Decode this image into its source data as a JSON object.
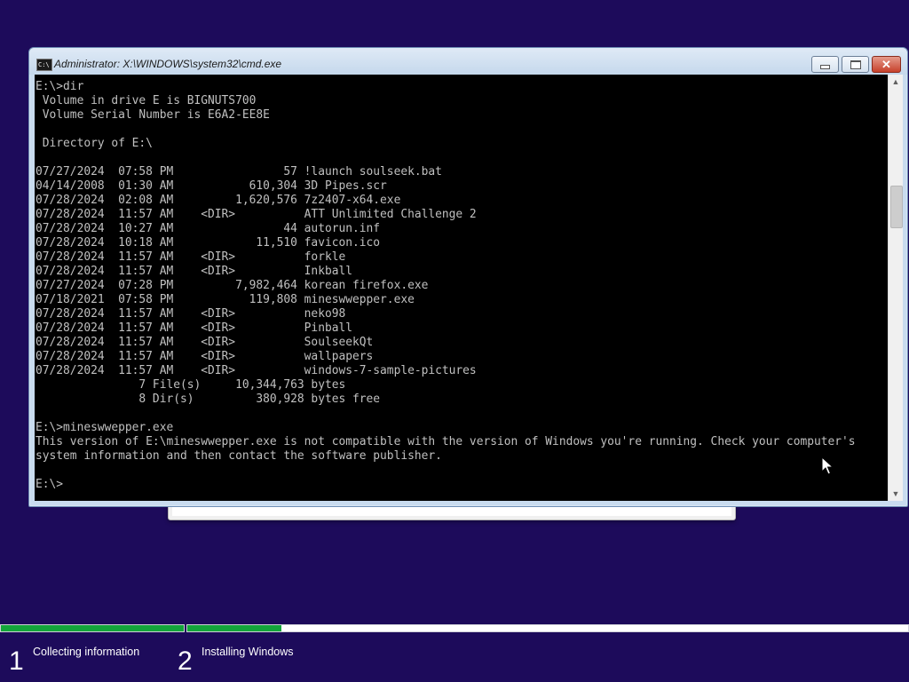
{
  "window": {
    "title": "Administrator: X:\\WINDOWS\\system32\\cmd.exe",
    "icon": "console-icon",
    "controls": {
      "minimize": "minimize-icon",
      "maximize": "maximize-icon",
      "close": "close-icon"
    }
  },
  "console": {
    "text": "E:\\>dir\n Volume in drive E is BIGNUTS700\n Volume Serial Number is E6A2-EE8E\n\n Directory of E:\\\n\n07/27/2024  07:58 PM                57 !launch soulseek.bat\n04/14/2008  01:30 AM           610,304 3D Pipes.scr\n07/28/2024  02:08 AM         1,620,576 7z2407-x64.exe\n07/28/2024  11:57 AM    <DIR>          ATT Unlimited Challenge 2\n07/28/2024  10:27 AM                44 autorun.inf\n07/28/2024  10:18 AM            11,510 favicon.ico\n07/28/2024  11:57 AM    <DIR>          forkle\n07/28/2024  11:57 AM    <DIR>          Inkball\n07/27/2024  07:28 PM         7,982,464 korean firefox.exe\n07/18/2021  07:58 PM           119,808 mineswwepper.exe\n07/28/2024  11:57 AM    <DIR>          neko98\n07/28/2024  11:57 AM    <DIR>          Pinball\n07/28/2024  11:57 AM    <DIR>          SoulseekQt\n07/28/2024  11:57 AM    <DIR>          wallpapers\n07/28/2024  11:57 AM    <DIR>          windows-7-sample-pictures\n               7 File(s)     10,344,763 bytes\n               8 Dir(s)         380,928 bytes free\n\nE:\\>mineswwepper.exe\nThis version of E:\\mineswwepper.exe is not compatible with the version of Windows you're running. Check your computer's\nsystem information and then contact the software publisher.\n\nE:\\>"
  },
  "scrollbar": {
    "up": "▲",
    "down": "▼"
  },
  "progress": {
    "steps": [
      {
        "number": "1",
        "label": "Collecting information",
        "progress": 1.0
      },
      {
        "number": "2",
        "label": "Installing Windows",
        "progress": 0.13
      }
    ]
  },
  "colors": {
    "background": "#1d0b5b",
    "console_bg": "#000000",
    "console_fg": "#c0c0c0",
    "progress_fill": "#13a53b"
  }
}
